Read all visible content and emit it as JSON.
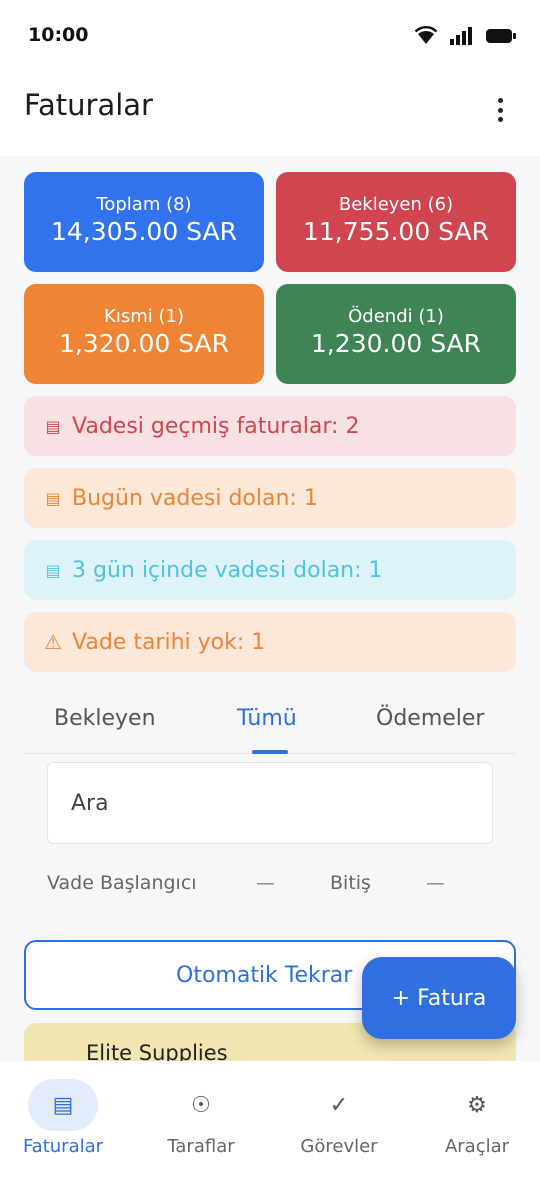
{
  "status_bar": {
    "time": "10:00",
    "icons": [
      "wifi-icon",
      "signal-icon",
      "battery-icon"
    ]
  },
  "app_bar": {
    "title": "Faturalar",
    "menu_icon": "more-vertical-icon"
  },
  "summary_cards": {
    "total": {
      "label": "Toplam (8)",
      "value": "14,305.00 SAR",
      "color": "#3172ed"
    },
    "pending": {
      "label": "Bekleyen (6)",
      "value": "11,755.00 SAR",
      "color": "#d04550"
    },
    "partial": {
      "label": "Kısmi (1)",
      "value": "1,320.00 SAR",
      "color": "#ee8434"
    },
    "paid": {
      "label": "Ödendi (1)",
      "value": "1,230.00 SAR",
      "color": "#3e8454"
    }
  },
  "alerts": {
    "overdue": {
      "icon": "▤",
      "text": "Vadesi geçmiş faturalar: 2"
    },
    "due_today": {
      "icon": "▤",
      "text": "Bugün vadesi dolan: 1"
    },
    "due_3days": {
      "icon": "▤",
      "text": "3 gün içinde vadesi dolan: 1"
    },
    "no_date": {
      "icon": "⚠",
      "text": "Vade tarihi yok: 1"
    }
  },
  "tabs": {
    "pending": "Bekleyen",
    "all": "Tümü",
    "payments": "Ödemeler",
    "active": "all"
  },
  "search": {
    "placeholder": "Ara"
  },
  "date_filter": {
    "start_label": "Vade Başlangıcı",
    "start_value": "—",
    "end_label": "Bitiş",
    "end_value": "—"
  },
  "auto_repeat_button": {
    "label": "Otomatik Tekrar"
  },
  "invoice_list": [
    {
      "party": "Elite Supplies",
      "color": "#f1e5b1"
    }
  ],
  "fab": {
    "label": "+ Fatura"
  },
  "bottom_nav": {
    "invoices": {
      "label": "Faturalar",
      "icon": "▤",
      "active": true
    },
    "parties": {
      "label": "Taraflar",
      "icon": "☉"
    },
    "tasks": {
      "label": "Görevler",
      "icon": "✓"
    },
    "tools": {
      "label": "Araçlar",
      "icon": "⚙"
    }
  },
  "accent_color": "#2f6fe0"
}
